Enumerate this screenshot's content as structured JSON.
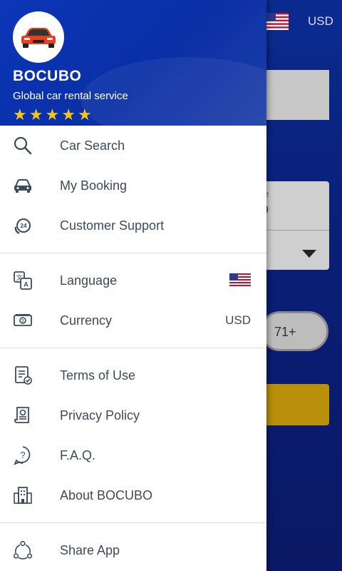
{
  "background": {
    "currency": "USD",
    "pill_label": "71+"
  },
  "drawer": {
    "brand_title": "BOCUBO",
    "brand_subtitle": "Global car rental service",
    "rating_stars": 5,
    "sections": [
      [
        {
          "label": "Car Search",
          "icon": "search-icon"
        },
        {
          "label": "My Booking",
          "icon": "car-icon"
        },
        {
          "label": "Customer Support",
          "icon": "support-24-icon"
        }
      ],
      [
        {
          "label": "Language",
          "icon": "translate-icon",
          "trailing_flag": "us-flag-icon"
        },
        {
          "label": "Currency",
          "icon": "banknote-icon",
          "trailing_text": "USD"
        }
      ],
      [
        {
          "label": "Terms of Use",
          "icon": "document-check-icon"
        },
        {
          "label": "Privacy Policy",
          "icon": "certificate-icon"
        },
        {
          "label": "F.A.Q.",
          "icon": "question-icon"
        },
        {
          "label": "About BOCUBO",
          "icon": "building-icon"
        }
      ],
      [
        {
          "label": "Share App",
          "icon": "share-icon"
        }
      ]
    ]
  },
  "colors": {
    "header_blue": "#0c36b8",
    "star_yellow": "#f5c518",
    "text_gray": "#3e4a59",
    "background_blue": "#0a1f78"
  }
}
